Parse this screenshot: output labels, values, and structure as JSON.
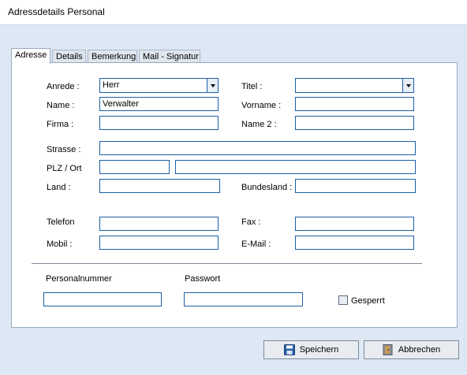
{
  "window": {
    "title": "Adressdetails Personal"
  },
  "tabs": [
    "Adresse",
    "Details",
    "Bemerkung",
    "Mail - Signatur"
  ],
  "form": {
    "anrede": {
      "label": "Anrede :",
      "value": "Herr"
    },
    "titel": {
      "label": "Titel :",
      "value": ""
    },
    "name": {
      "label": "Name :",
      "value": "Verwalter"
    },
    "vorname": {
      "label": "Vorname :",
      "value": ""
    },
    "firma": {
      "label": "Firma :",
      "value": ""
    },
    "name2": {
      "label": "Name 2 :",
      "value": ""
    },
    "strasse": {
      "label": "Strasse :",
      "value": ""
    },
    "plz_ort": {
      "label": "PLZ / Ort",
      "plz": "",
      "ort": ""
    },
    "land": {
      "label": "Land :",
      "value": ""
    },
    "bundesland": {
      "label": "Bundesland :",
      "value": ""
    },
    "telefon": {
      "label": "Telefon",
      "value": ""
    },
    "fax": {
      "label": "Fax :",
      "value": ""
    },
    "mobil": {
      "label": "Mobil :",
      "value": ""
    },
    "email": {
      "label": "E-Mail :",
      "value": ""
    },
    "personalnummer": {
      "label": "Personalnummer",
      "value": ""
    },
    "passwort": {
      "label": "Passwort",
      "value": ""
    },
    "gesperrt": {
      "label": "Gesperrt",
      "checked": false
    }
  },
  "buttons": {
    "save": "Speichern",
    "cancel": "Abbrechen"
  },
  "colors": {
    "accent_border": "#1c5fa5",
    "background": "#dde8f4"
  }
}
